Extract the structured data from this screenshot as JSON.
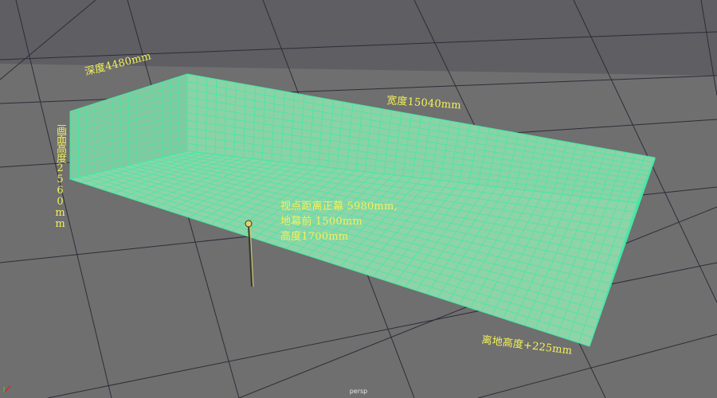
{
  "viewport": {
    "camera_label": "persp",
    "colors": {
      "background": "#6f6f6f",
      "sky_band": "#5e5e63",
      "floor_grid_line": "#2d2d3a",
      "screen_fill": "#8fd3a8",
      "screen_grid_line": "#45e8a6",
      "annotation_text": "#f2f25a"
    }
  },
  "annotations": {
    "depth": "深度4480mm",
    "width": "宽度15040mm",
    "screen_height": "画面高度2560mm",
    "viewpoint_lines": [
      "视点距离正幕 5980mm,",
      "地幕前 1500mm",
      "高度1700mm"
    ],
    "ground_height": "离地高度+225mm"
  },
  "icons": {
    "camera_marker": "camera-locator-icon",
    "axis_indicator": "axis-gizmo-icon"
  }
}
